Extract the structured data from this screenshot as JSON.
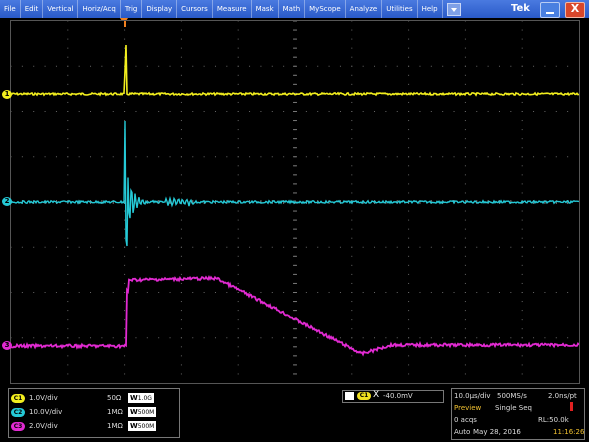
{
  "menubar": {
    "items": [
      "File",
      "Edit",
      "Vertical",
      "Horiz/Acq",
      "Trig",
      "Display",
      "Cursors",
      "Measure",
      "Mask",
      "Math",
      "MyScope",
      "Analyze",
      "Utilities",
      "Help"
    ],
    "brand": "Tek",
    "close_label": "X"
  },
  "colors": {
    "ch1": "#f2ee1e",
    "ch2": "#25c9d6",
    "ch3": "#e22ad2",
    "trigger": "#f08020",
    "menubar": "#2a5ac8"
  },
  "channels": [
    {
      "badge": "C1",
      "scale": "1.0V/div",
      "impedance": "50Ω",
      "bandwidth": "1.0G",
      "marker": "1"
    },
    {
      "badge": "C2",
      "scale": "10.0V/div",
      "impedance": "1MΩ",
      "bandwidth": "500M",
      "marker": "2"
    },
    {
      "badge": "C3",
      "scale": "2.0V/div",
      "impedance": "1MΩ",
      "bandwidth": "500M",
      "marker": "3"
    }
  ],
  "bw_prefix": "W",
  "trigger": {
    "source": "C1",
    "glyph": "Ⅹ",
    "level": "-40.0mV"
  },
  "acquisition": {
    "time_div": "10.0µs/div",
    "sample_rate": "500MS/s",
    "resolution": "2.0ns/pt",
    "preview": "Preview",
    "mode": "Single Seq",
    "acqs": "0 acqs",
    "record_length": "RL:50.0k",
    "trigger_mode": "Auto",
    "date": "May 28, 2016",
    "clock": "11:16:26"
  }
}
